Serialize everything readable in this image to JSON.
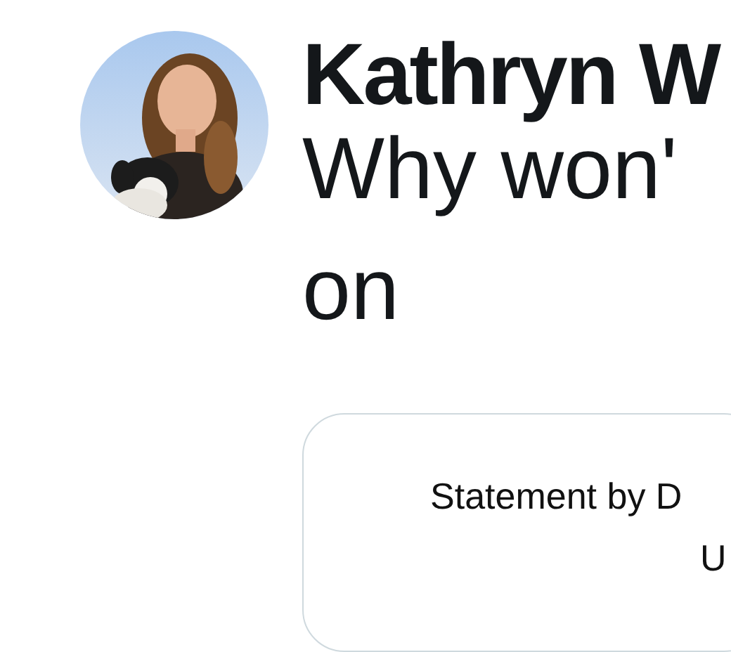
{
  "post": {
    "author": "Kathryn W",
    "text_lines": [
      "Why won'",
      "on"
    ],
    "card": {
      "lines": [
        "Statement by D",
        "U"
      ]
    }
  }
}
